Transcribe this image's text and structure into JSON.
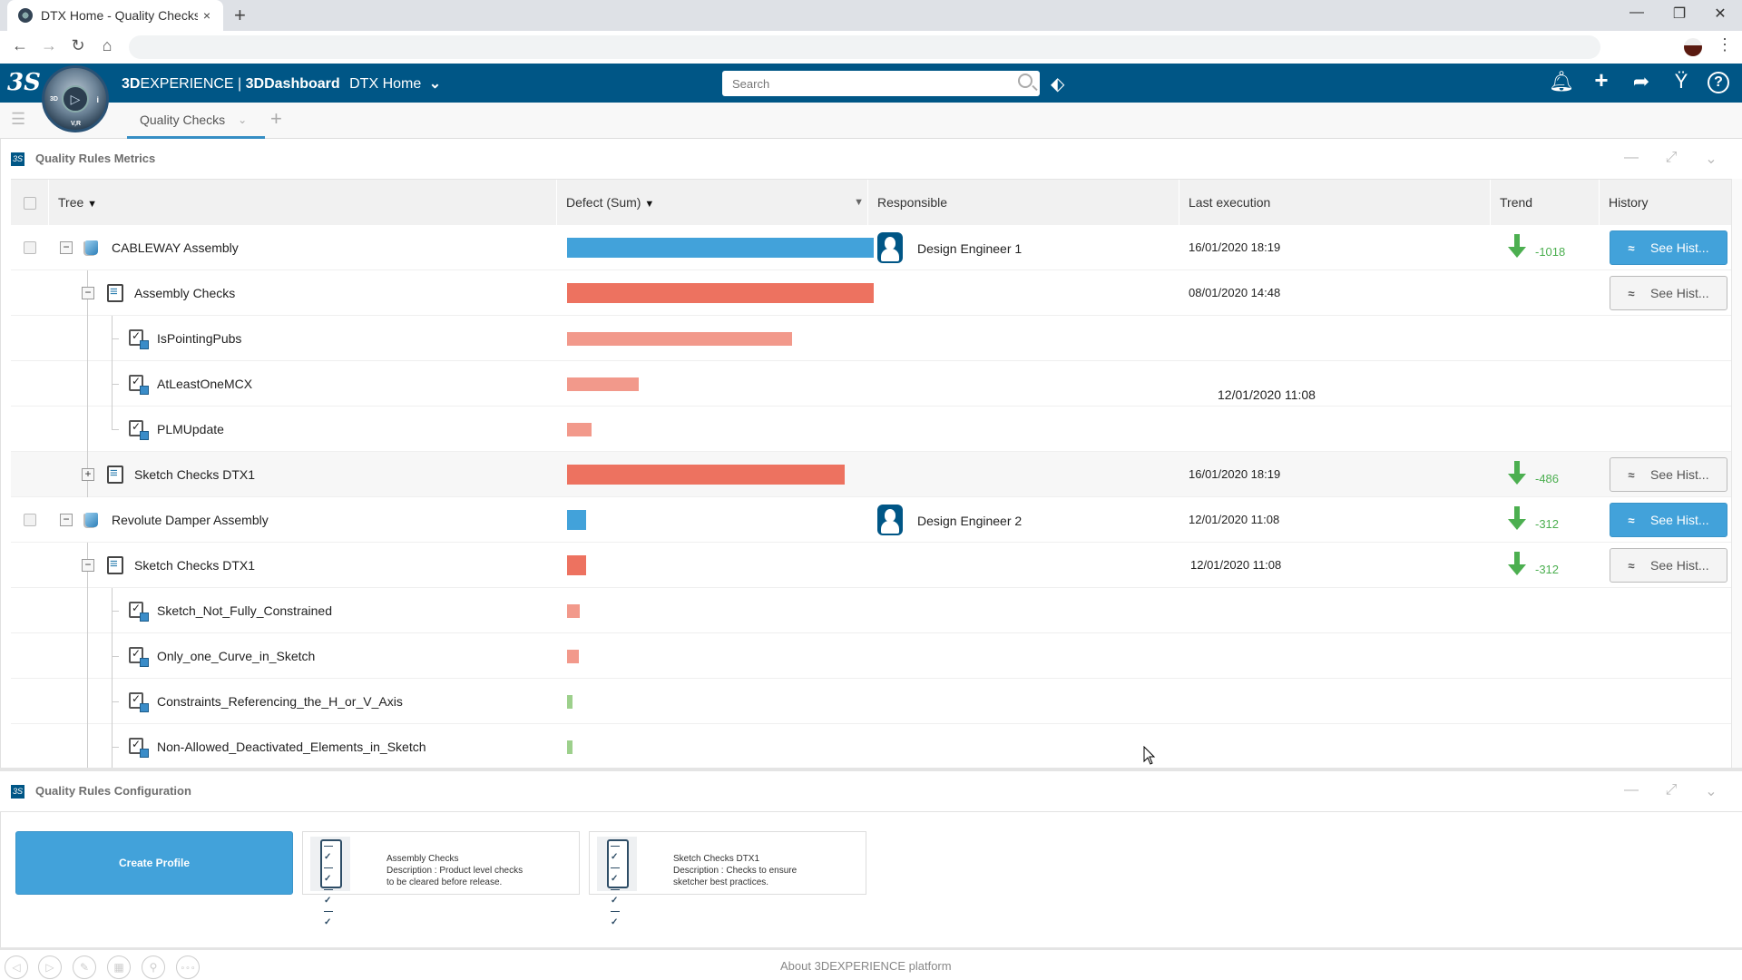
{
  "browser": {
    "tab_title": "DTX Home - Quality Checks",
    "new_tab": "+",
    "window_controls": {
      "minimize": "—",
      "restore": "❐",
      "close": "✕"
    },
    "nav": {
      "back": "←",
      "forward": "→",
      "reload": "↻",
      "home": "⌂"
    },
    "menu": "⋮"
  },
  "header": {
    "logo": "3S",
    "brand_bold_prefix": "3D",
    "brand_rest": "EXPERIENCE | ",
    "app_name": "3DDashboard",
    "dashboard_name": "DTX Home",
    "dashboard_chevron": "⌄",
    "search_placeholder": "Search",
    "compass_labels": {
      "left": "3D",
      "right": "i",
      "bottom": "V,R",
      "center": "▷"
    },
    "icons": [
      "notifications-icon",
      "add-icon",
      "share-icon",
      "community-icon",
      "help-icon"
    ],
    "icon_glyphs": [
      "🔔︎",
      "+",
      "➦",
      "Ÿ",
      "?"
    ],
    "tag_glyph": "⬖"
  },
  "tabstrip": {
    "sidebar_toggle": "☰",
    "active_tab": "Quality Checks",
    "tab_chevron": "⌄",
    "add_tab": "+"
  },
  "metrics": {
    "title": "Quality Rules Metrics",
    "panel_controls": {
      "minimize": "—",
      "maximize": "⤢",
      "collapse": "⌄"
    },
    "columns": {
      "tree": "Tree",
      "defect": "Defect (Sum)",
      "responsible": "Responsible",
      "last_execution": "Last execution",
      "trend": "Trend",
      "history": "History"
    },
    "filter_glyph": "▼",
    "sort_glyph": "▼",
    "history_button_label": "See Hist...",
    "history_button_glyph": "≈",
    "rows": [
      {
        "level": 0,
        "label": "CABLEWAY Assembly",
        "icon": "assembly",
        "expander": "−",
        "checkbox": true,
        "defect_ratio": 1.0,
        "bar_color": "#42a2da",
        "responsible": "Design Engineer 1",
        "last_execution": "16/01/2020 18:19",
        "trend": "-1018",
        "history": "primary"
      },
      {
        "level": 1,
        "label": "Assembly Checks",
        "icon": "checklist",
        "expander": "−",
        "defect_ratio": 1.0,
        "bar_color": "#ed7260",
        "last_execution": "08/01/2020 14:48",
        "history": "default"
      },
      {
        "level": 2,
        "label": "IsPointingPubs",
        "icon": "rule",
        "defect_ratio": 0.733,
        "bar_color": "#f2998b"
      },
      {
        "level": 2,
        "label": "AtLeastOneMCX",
        "icon": "rule",
        "defect_ratio": 0.234,
        "bar_color": "#f2998b",
        "last_execution_offset": "12/01/2020 11:08"
      },
      {
        "level": 2,
        "label": "PLMUpdate",
        "icon": "rule",
        "defect_ratio": 0.08,
        "bar_color": "#f2998b",
        "last": true
      },
      {
        "level": 1,
        "label": "Sketch Checks DTX1",
        "icon": "checklist",
        "expander": "+",
        "defect_ratio": 0.905,
        "bar_color": "#ed7260",
        "last_execution": "16/01/2020 18:19",
        "trend": "-486",
        "history": "default",
        "alt": true
      },
      {
        "level": 0,
        "label": "Revolute Damper Assembly",
        "icon": "assembly",
        "expander": "−",
        "checkbox": true,
        "defect_ratio": 0.062,
        "bar_color": "#42a2da",
        "responsible": "Design Engineer 2",
        "last_execution": "12/01/2020 11:08",
        "trend": "-312",
        "history": "primary"
      },
      {
        "level": 1,
        "label": "Sketch Checks DTX1",
        "icon": "checklist",
        "expander": "−",
        "defect_ratio": 0.062,
        "bar_color": "#ed7260",
        "last_execution": "12/01/2020 11:08",
        "trend": "-312",
        "history": "default"
      },
      {
        "level": 2,
        "label": "Sketch_Not_Fully_Constrained",
        "icon": "rule",
        "defect_ratio": 0.041,
        "bar_color": "#f2998b"
      },
      {
        "level": 2,
        "label": "Only_one_Curve_in_Sketch",
        "icon": "rule",
        "defect_ratio": 0.038,
        "bar_color": "#f2998b"
      },
      {
        "level": 2,
        "label": "Constraints_Referencing_the_H_or_V_Axis",
        "icon": "rule",
        "defect_ratio": 0.018,
        "bar_color": "#9dd08c"
      },
      {
        "level": 2,
        "label": "Non-Allowed_Deactivated_Elements_in_Sketch",
        "icon": "rule",
        "defect_ratio": 0.018,
        "bar_color": "#9dd08c"
      }
    ]
  },
  "configuration": {
    "title": "Quality Rules Configuration",
    "panel_controls": {
      "minimize": "—",
      "maximize": "⤢",
      "collapse": "⌄"
    },
    "create_profile_label": "Create Profile",
    "profiles": [
      {
        "name": "Assembly Checks",
        "description": "Description : Product level checks",
        "description2": "to be cleared before release."
      },
      {
        "name": "Sketch Checks DTX1",
        "description": "Description : Checks to ensure",
        "description2": "sketcher best practices."
      }
    ]
  },
  "bottombar": {
    "buttons": [
      "◁",
      "▷",
      "✎",
      "▦",
      "⚲",
      "∘∘∘"
    ],
    "about": "About 3DEXPERIENCE platform"
  },
  "colors": {
    "brand_blue": "#005686",
    "accent_blue": "#42a2da",
    "defect_high": "#ed7260",
    "defect_mid": "#f2998b",
    "defect_low": "#9dd08c",
    "trend_good": "#4caf50"
  }
}
